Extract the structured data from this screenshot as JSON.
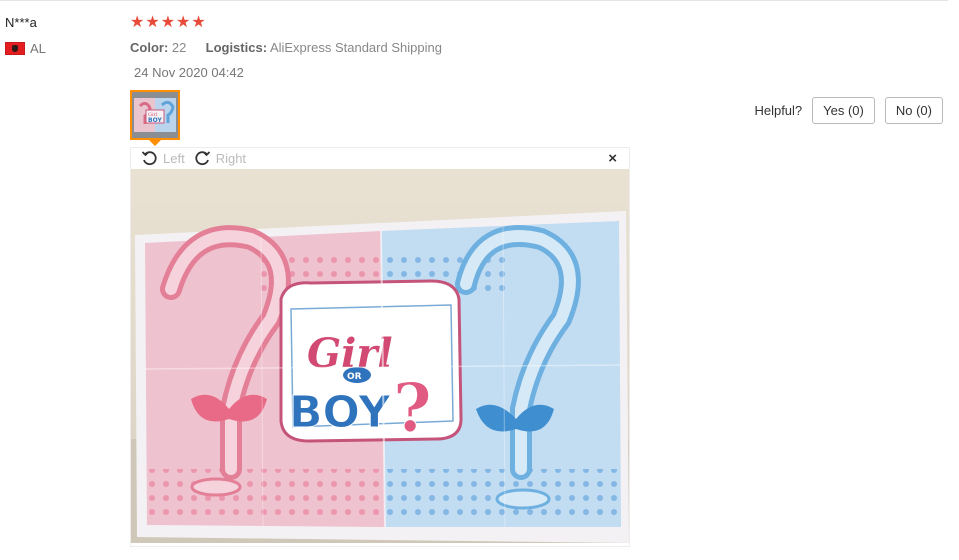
{
  "review": {
    "user_name": "N***a",
    "country_code": "AL",
    "rating": 5,
    "star_glyph": "★",
    "star_color": "#e84b3a",
    "properties": [
      {
        "key": "Color:",
        "value": "22"
      },
      {
        "key": "Logistics:",
        "value": "AliExpress Standard Shipping"
      }
    ],
    "date": "24 Nov 2020 04:42"
  },
  "helpful": {
    "label": "Helpful?",
    "yes_label": "Yes (0)",
    "no_label": "No (0)"
  },
  "viewer": {
    "rotate_left_label": "Left",
    "rotate_right_label": "Right",
    "close_glyph": "×",
    "photo_text": {
      "word1": "Girl",
      "word2": "OR",
      "word3": "BOY",
      "mark": "?"
    }
  },
  "colors": {
    "accent": "#ff8f00",
    "flag_red": "#e41e20"
  }
}
